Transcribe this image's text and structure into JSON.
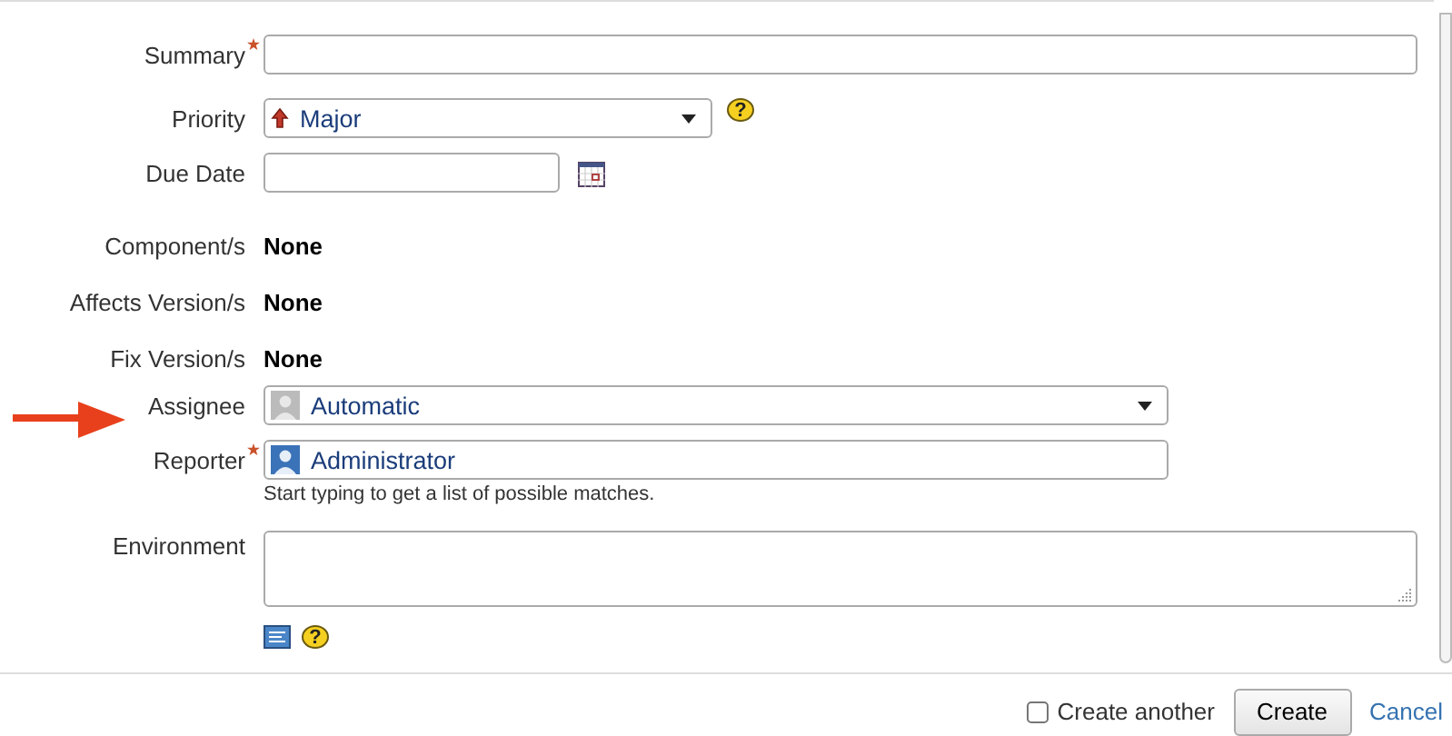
{
  "fields": [
    {
      "kind": "text",
      "label": "Summary",
      "required": true
    },
    {
      "kind": "priority",
      "label": "Priority",
      "required": false,
      "value": "Major",
      "help": "?"
    },
    {
      "kind": "date",
      "label": "Due Date",
      "required": false
    },
    {
      "kind": "value",
      "label": "Component/s",
      "required": false,
      "value": "None"
    },
    {
      "kind": "value",
      "label": "Affects Version/s",
      "required": false,
      "value": "None"
    },
    {
      "kind": "value",
      "label": "Fix Version/s",
      "required": false,
      "value": "None"
    },
    {
      "kind": "assignee",
      "label": "Assignee",
      "required": false,
      "value": "Automatic"
    },
    {
      "kind": "user",
      "label": "Reporter",
      "required": true,
      "value": "Administrator",
      "hint": "Start typing to get a list of possible matches."
    },
    {
      "kind": "textarea",
      "label": "Environment",
      "required": false,
      "help": "?"
    }
  ],
  "footer": {
    "create_another": {
      "label": "Create another",
      "checked": false
    },
    "create": "Create",
    "cancel": "Cancel"
  }
}
